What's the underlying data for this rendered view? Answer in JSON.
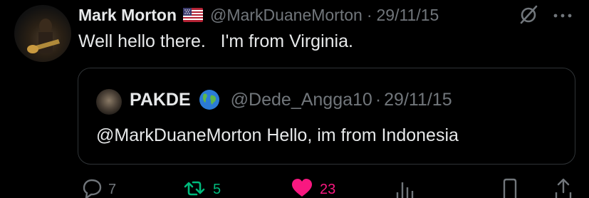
{
  "tweet": {
    "author_name": "Mark Morton",
    "author_flag": "us-flag-emoji",
    "author_handle": "@MarkDuaneMorton",
    "separator": "·",
    "date": "29/11/15",
    "text": "Well hello there.   I'm from Virginia."
  },
  "quoted_tweet": {
    "author_name": "PAKDE",
    "author_badge": "globe-emoji",
    "author_handle": "@Dede_Angga10",
    "separator": "·",
    "date": "29/11/15",
    "text": "@MarkDuaneMorton Hello, im from Indonesia"
  },
  "actions": {
    "reply_count": "7",
    "retweet_count": "5",
    "like_count": "23"
  },
  "colors": {
    "background": "#000000",
    "text": "#e7e9ea",
    "muted": "#71767b",
    "retweet": "#00ba7c",
    "like": "#f91880",
    "border": "#2f3336"
  }
}
